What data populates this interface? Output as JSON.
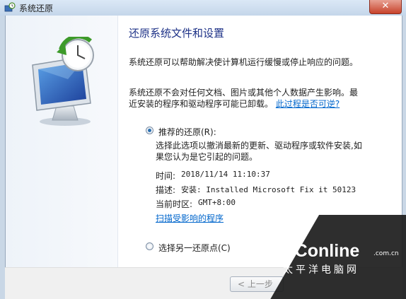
{
  "window": {
    "title": "系统还原",
    "close_symbol": "✕"
  },
  "main": {
    "heading": "还原系统文件和设置",
    "description1": "系统还原可以帮助解决使计算机运行缓慢或停止响应的问题。",
    "description2": "系统还原不会对任何文档、图片或其他个人数据产生影响。最近安装的程序和驱动程序可能已卸载。",
    "reversible_link": "此过程是否可逆?",
    "recommended_label": "推荐的还原(R):",
    "recommended_desc": "选择此选项以撤消最新的更新、驱动程序或软件安装,如果您认为是它引起的问题。",
    "details": {
      "time_label": "时间:",
      "time_value": "2018/11/14 11:10:37",
      "desc_label": "描述:",
      "desc_value": "安装: Installed Microsoft Fix it 50123",
      "timezone_label": "当前时区:",
      "timezone_value": "GMT+8:00"
    },
    "scan_link": "扫描受影响的程序",
    "other_label": "选择另一还原点(C)"
  },
  "buttons": {
    "prev_label": "< 上一步"
  },
  "watermark": {
    "brand": "PConline",
    "domain": ".com.cn",
    "cn": "太平洋电脑网"
  },
  "icons": {
    "app": "system-restore-icon",
    "graphic": "restore-monitor-clock-icon"
  },
  "colors": {
    "heading": "#1e3287",
    "link": "#0066cc",
    "close": "#c7432b"
  }
}
